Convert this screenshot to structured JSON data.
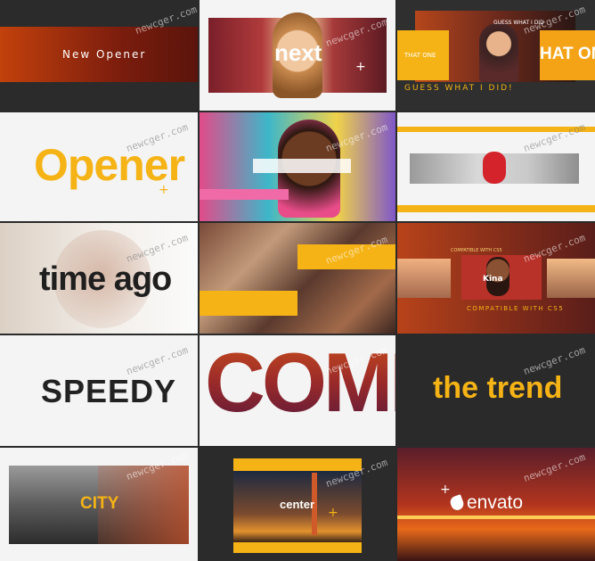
{
  "tiles": {
    "r1c1": {
      "text": "New Opener"
    },
    "r1c2": {
      "text": "next"
    },
    "r1c3": {
      "left": "THAT ONE",
      "right": "HAT ON",
      "tagline": "GUESS WHAT I DID!",
      "small": "GUESS WHAT I DID"
    },
    "r2c1": {
      "text": "Opener"
    },
    "r3c1": {
      "text": "time ago"
    },
    "r3c3": {
      "small": "COMPATIBLE WITH CS5",
      "name": "Kina",
      "tagline": "COMPATIBLE WITH CS5"
    },
    "r4c1": {
      "text": "SPEEDY"
    },
    "r4c2": {
      "text": "COME"
    },
    "r4c3": {
      "text": "the trend"
    },
    "r5c1": {
      "text": "CITY"
    },
    "r5c2": {
      "text": "center"
    },
    "r5c3": {
      "text": "envato"
    }
  },
  "watermark": "newcger.com",
  "colors": {
    "accent": "#f5b316",
    "dark": "#242424",
    "light": "#f4f4f4"
  }
}
